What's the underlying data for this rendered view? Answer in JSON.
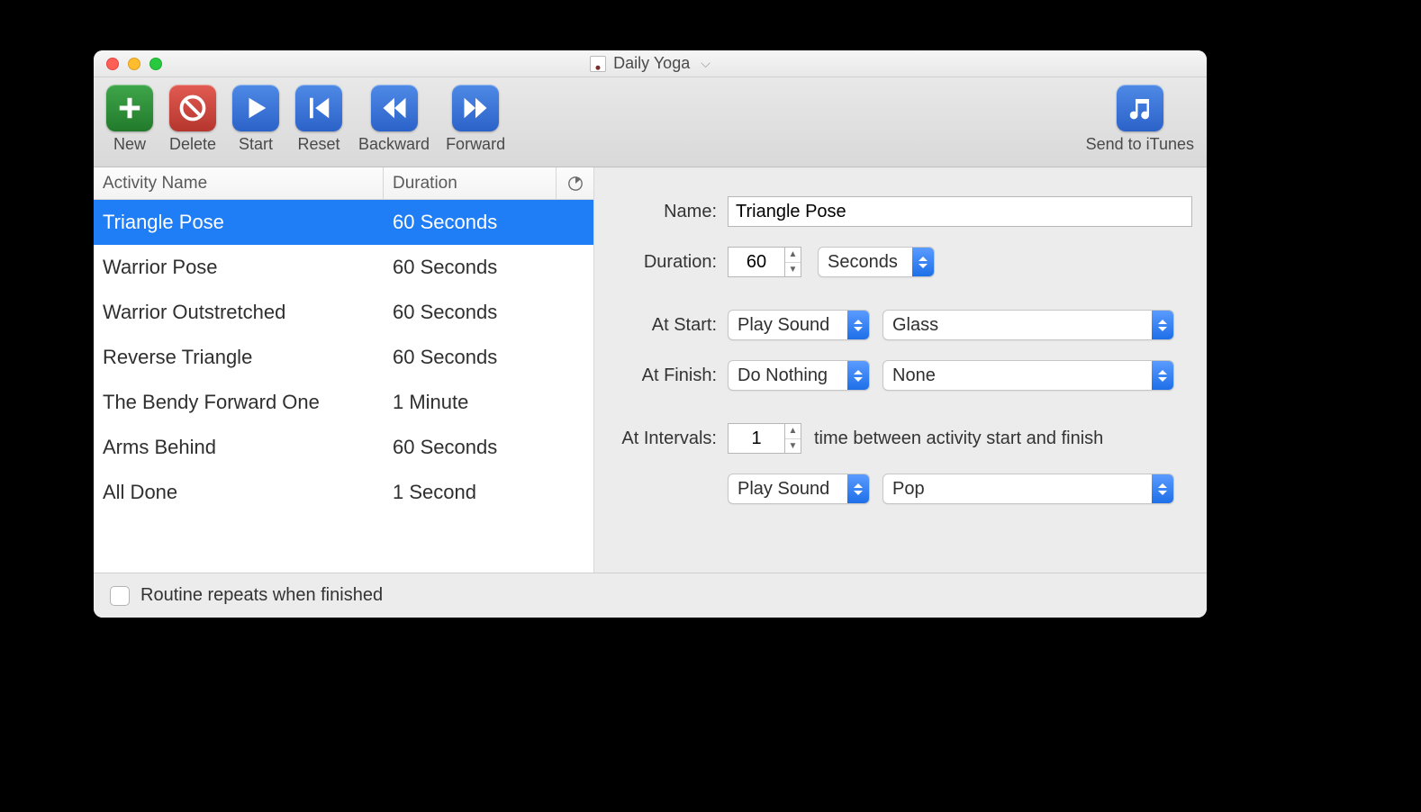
{
  "window": {
    "title": "Daily Yoga"
  },
  "toolbar": {
    "new": "New",
    "delete": "Delete",
    "start": "Start",
    "reset": "Reset",
    "backward": "Backward",
    "forward": "Forward",
    "send_to_itunes": "Send to iTunes"
  },
  "columns": {
    "activity_name": "Activity Name",
    "duration": "Duration"
  },
  "activities": [
    {
      "name": "Triangle Pose",
      "duration": "60 Seconds",
      "selected": true
    },
    {
      "name": "Warrior Pose",
      "duration": "60 Seconds",
      "selected": false
    },
    {
      "name": "Warrior Outstretched",
      "duration": "60 Seconds",
      "selected": false
    },
    {
      "name": "Reverse Triangle",
      "duration": "60 Seconds",
      "selected": false
    },
    {
      "name": "The Bendy Forward One",
      "duration": "1 Minute",
      "selected": false
    },
    {
      "name": "Arms Behind",
      "duration": "60 Seconds",
      "selected": false
    },
    {
      "name": "All Done",
      "duration": "1 Second",
      "selected": false
    }
  ],
  "detail": {
    "labels": {
      "name": "Name:",
      "duration": "Duration:",
      "at_start": "At Start:",
      "at_finish": "At Finish:",
      "at_intervals": "At Intervals:"
    },
    "name_value": "Triangle Pose",
    "duration_value": "60",
    "duration_unit": "Seconds",
    "at_start_action": "Play Sound",
    "at_start_sound": "Glass",
    "at_finish_action": "Do Nothing",
    "at_finish_sound": "None",
    "interval_value": "1",
    "interval_text": "time between activity start and finish",
    "interval_action": "Play Sound",
    "interval_sound": "Pop"
  },
  "footer": {
    "repeat_label": "Routine repeats when finished",
    "repeat_checked": false
  }
}
